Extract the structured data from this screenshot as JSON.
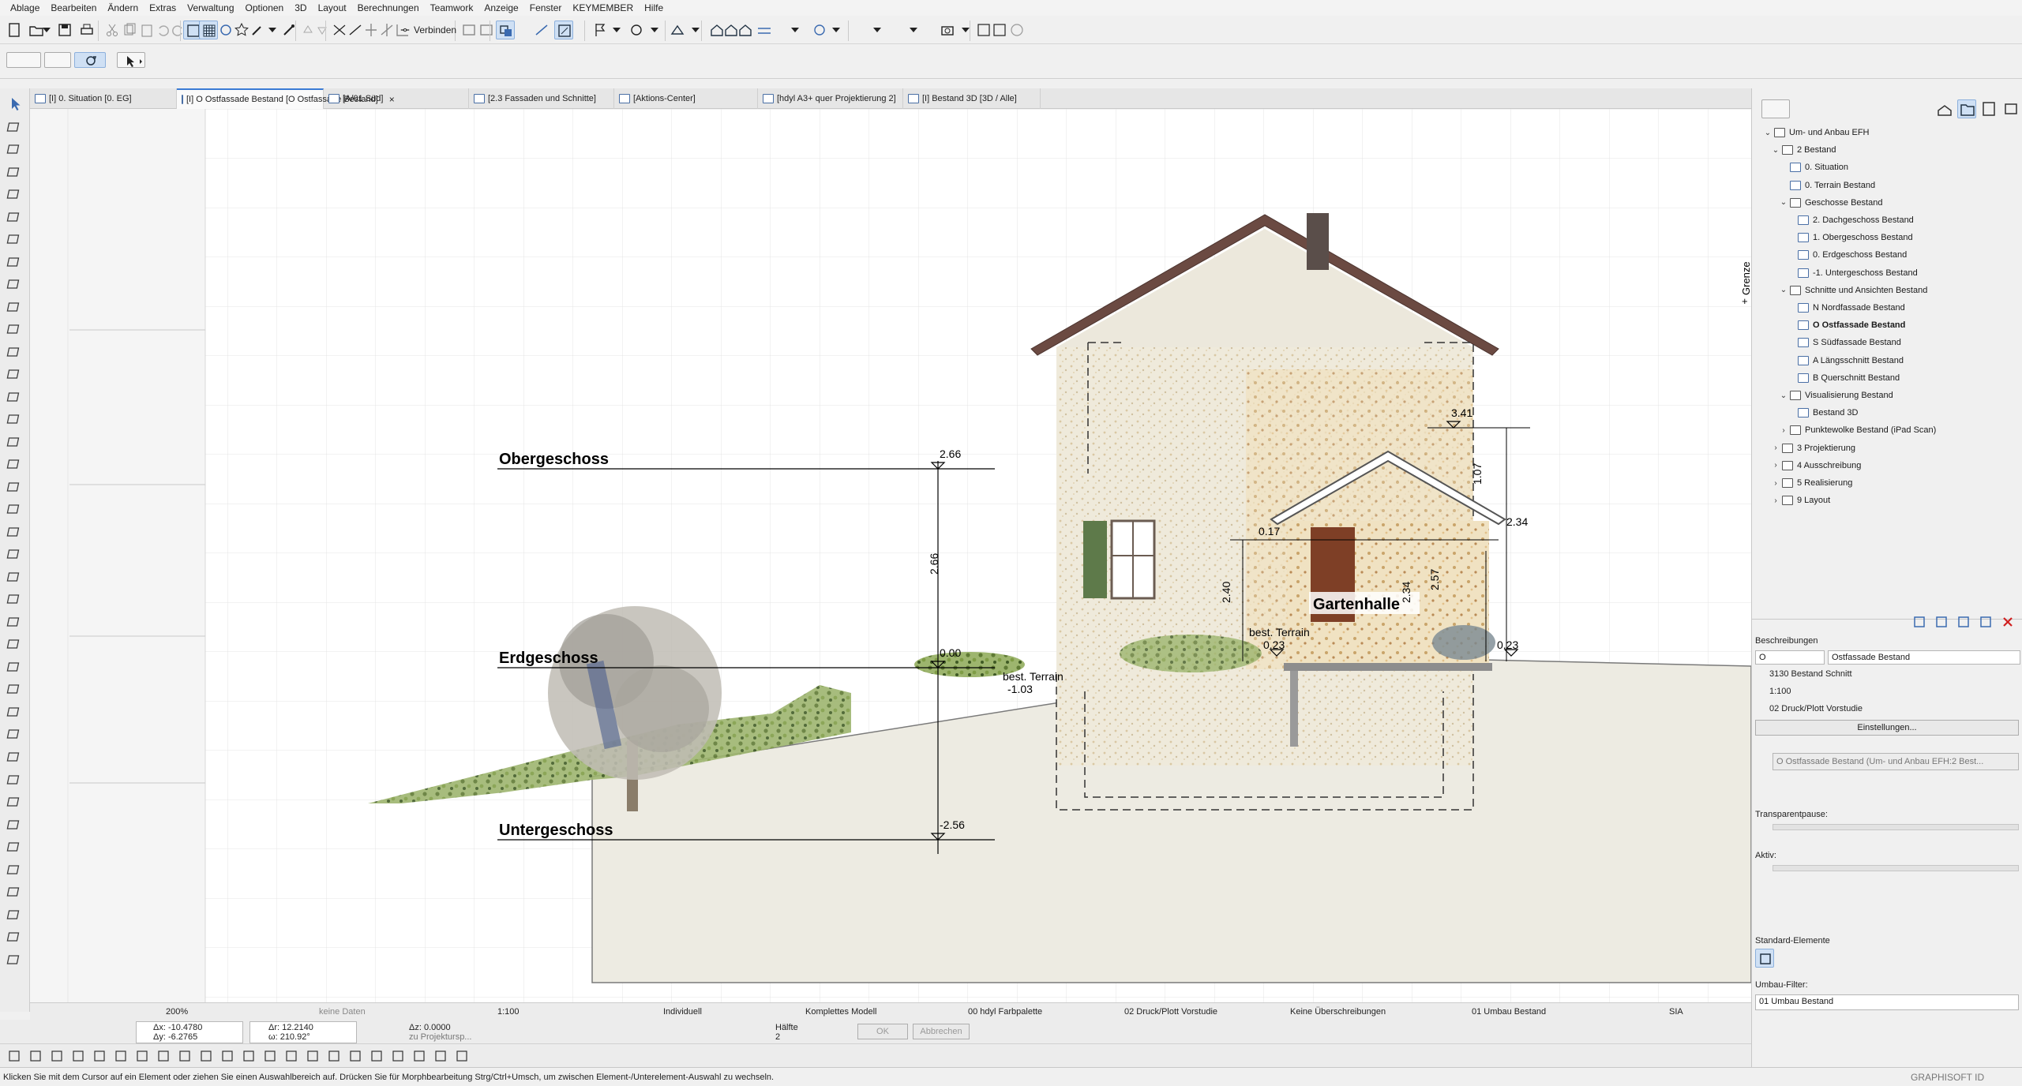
{
  "menu": [
    "Ablage",
    "Bearbeiten",
    "Ändern",
    "Extras",
    "Verwaltung",
    "Optionen",
    "3D",
    "Layout",
    "Berechnungen",
    "Teamwork",
    "Anzeige",
    "Fenster",
    "KEYMEMBER",
    "Hilfe"
  ],
  "toolbar": {
    "connect_label": "Verbinden"
  },
  "tabs": [
    {
      "label": "[I] 0. Situation [0. EG]",
      "active": false
    },
    {
      "label": "[I] O Ostfassade Bestand [O Ostfassade Bestand]",
      "active": true,
      "close": "×"
    },
    {
      "label": "[A/01 Süd]",
      "active": false
    },
    {
      "label": "[2.3 Fassaden und Schnitte]",
      "active": false
    },
    {
      "label": "[Aktions-Center]",
      "active": false
    },
    {
      "label": "[hdyl A3+ quer Projektierung 2]",
      "active": false
    },
    {
      "label": "[I] Bestand 3D [3D / Alle]",
      "active": false
    }
  ],
  "drawing": {
    "grenze_label": "Grenze",
    "levels": [
      {
        "name": "Obergeschoss",
        "elevation": "2.66"
      },
      {
        "name": "Erdgeschoss",
        "elevation": "0.00"
      },
      {
        "name": "Untergeschoss",
        "elevation": "-2.56"
      }
    ],
    "room_label": "Gartenhalle",
    "dimension_labels": [
      "3.41",
      "2.66",
      "1.07",
      "2.34",
      "2.40",
      "2.57",
      "2.34",
      "0.17",
      "0.23",
      "0.23",
      "-1.03"
    ],
    "terrain_labels": [
      "best. Terrain",
      "best. Terrain"
    ]
  },
  "navigator": {
    "items": [
      {
        "label": "Um- und Anbau EFH",
        "depth": 0,
        "twist": "⌄",
        "icon": "folder"
      },
      {
        "label": "2 Bestand",
        "depth": 1,
        "twist": "⌄",
        "icon": "folder"
      },
      {
        "label": "0. Situation",
        "depth": 2,
        "twist": "",
        "icon": "view"
      },
      {
        "label": "0. Terrain Bestand",
        "depth": 2,
        "twist": "",
        "icon": "view"
      },
      {
        "label": "Geschosse Bestand",
        "depth": 2,
        "twist": "⌄",
        "icon": "folder"
      },
      {
        "label": "2. Dachgeschoss Bestand",
        "depth": 3,
        "twist": "",
        "icon": "view"
      },
      {
        "label": "1. Obergeschoss Bestand",
        "depth": 3,
        "twist": "",
        "icon": "view"
      },
      {
        "label": "0. Erdgeschoss Bestand",
        "depth": 3,
        "twist": "",
        "icon": "view"
      },
      {
        "label": "-1. Untergeschoss Bestand",
        "depth": 3,
        "twist": "",
        "icon": "view"
      },
      {
        "label": "Schnitte und Ansichten Bestand",
        "depth": 2,
        "twist": "⌄",
        "icon": "folder"
      },
      {
        "label": "N Nordfassade Bestand",
        "depth": 3,
        "twist": "",
        "icon": "view"
      },
      {
        "label": "O Ostfassade Bestand",
        "depth": 3,
        "twist": "",
        "icon": "view",
        "bold": true
      },
      {
        "label": "S Südfassade Bestand",
        "depth": 3,
        "twist": "",
        "icon": "view"
      },
      {
        "label": "A Längsschnitt Bestand",
        "depth": 3,
        "twist": "",
        "icon": "view"
      },
      {
        "label": "B Querschnitt Bestand",
        "depth": 3,
        "twist": "",
        "icon": "view"
      },
      {
        "label": "Visualisierung Bestand",
        "depth": 2,
        "twist": "⌄",
        "icon": "folder"
      },
      {
        "label": "Bestand 3D",
        "depth": 3,
        "twist": "",
        "icon": "view"
      },
      {
        "label": "Punktewolke Bestand (iPad Scan)",
        "depth": 2,
        "twist": "›",
        "icon": "folder"
      },
      {
        "label": "3 Projektierung",
        "depth": 1,
        "twist": "›",
        "icon": "folder"
      },
      {
        "label": "4 Ausschreibung",
        "depth": 1,
        "twist": "›",
        "icon": "folder"
      },
      {
        "label": "5 Realisierung",
        "depth": 1,
        "twist": "›",
        "icon": "folder"
      },
      {
        "label": "9 Layout",
        "depth": 1,
        "twist": "›",
        "icon": "folder"
      }
    ]
  },
  "properties": {
    "section_title": "Beschreibungen",
    "id_value": "O",
    "name_value": "Ostfassade Bestand",
    "row_schnitt": "3130 Bestand Schnitt",
    "row_scale": "1:100",
    "row_penset": "02 Druck/Plott Vorstudie",
    "settings_button": "Einstellungen...",
    "source_field": "O Ostfassade Bestand (Um- und Anbau EFH:2 Best...",
    "transparent_label": "Transparentpause:",
    "aktiv_label": "Aktiv:",
    "standard_label": "Standard-Elemente",
    "umbau_label": "Umbau-Filter:",
    "umbau_value": "01 Umbau Bestand"
  },
  "infobar": {
    "zoom": "200%",
    "no_data": "keine Daten",
    "scale": "1:100",
    "layer": "Individuell",
    "model": "Komplettes Modell",
    "pen": "00 hdyl Farbpalette",
    "penset": "02 Druck/Plott Vorstudie",
    "override": "Keine Überschreibungen",
    "renovation": "01 Umbau Bestand",
    "dimension": "SIA"
  },
  "coords": {
    "dx": "Δx: -10.4780",
    "dy": "Δy: -6.2765",
    "dr": "Δr: 12.2140",
    "angle": "ω: 210.92°",
    "dz": "Δz: 0.0000",
    "dz_ref": "zu Projektursp...",
    "half_label": "Hälfte",
    "half_value": "2",
    "ok": "OK",
    "cancel": "Abbrechen"
  },
  "status": {
    "hint": "Klicken Sie mit dem Cursor auf ein Element oder ziehen Sie einen Auswahlbereich auf. Drücken Sie für Morphbearbeitung Strg/Ctrl+Umsch, um zwischen Element-/Unterelement-Auswahl zu wechseln.",
    "brand": "GRAPHISOFT ID"
  }
}
